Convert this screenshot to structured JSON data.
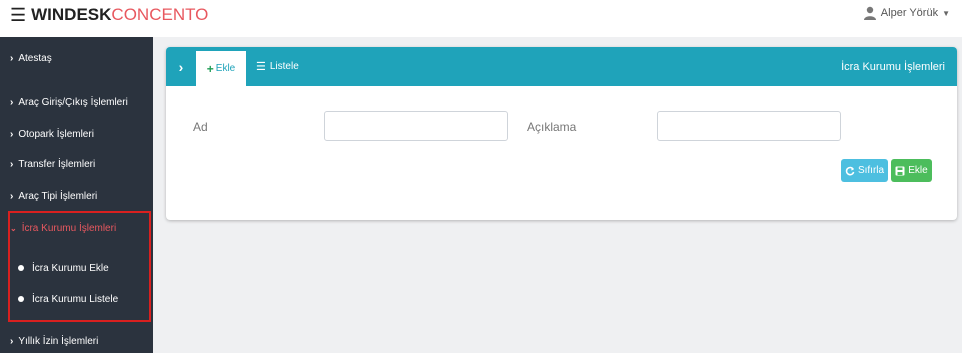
{
  "header": {
    "hamburger": "☰",
    "brand_bold": "WINDESK",
    "brand_light": "CONCENTO",
    "user_name": "Alper Yörük",
    "user_caret": "▼",
    "user_icon": "user-icon"
  },
  "sidebar": {
    "items": [
      {
        "label": "Atestaş",
        "icon": "chevron-right-icon"
      },
      {
        "label": "Araç Giriş/Çıkış İşlemleri",
        "icon": "chevron-right-icon"
      },
      {
        "label": "Otopark İşlemleri",
        "icon": "chevron-right-icon"
      },
      {
        "label": "Transfer İşlemleri",
        "icon": "chevron-right-icon"
      },
      {
        "label": "Araç Tipi İşlemleri",
        "icon": "chevron-right-icon"
      },
      {
        "label": "İcra Kurumu İşlemleri",
        "icon": "chevron-down-icon",
        "active": true
      },
      {
        "label": "Yıllık İzin İşlemleri",
        "icon": "chevron-right-icon"
      }
    ],
    "subitems": [
      {
        "label": "İcra Kurumu Ekle"
      },
      {
        "label": "İcra Kurumu Listele"
      }
    ],
    "chevron_right": "›",
    "chevron_down": "⌄"
  },
  "panel": {
    "toggle": "›",
    "tab_add": "Ekle",
    "tab_add_icon": "+",
    "tab_list": "Listele",
    "tab_list_icon": "☰",
    "title": "İcra Kurumu İşlemleri"
  },
  "form": {
    "ad_label": "Ad",
    "ad_value": "",
    "aciklama_label": "Açıklama",
    "aciklama_value": "",
    "reset_button": "Sıfırla",
    "add_button": "Ekle"
  },
  "colors": {
    "accent": "#1fa3ba",
    "brand_red": "#e8585f",
    "sidebar_bg": "#2b333e",
    "highlight": "#d9201f",
    "reset": "#4dbfe0",
    "add": "#4cbd5c"
  }
}
